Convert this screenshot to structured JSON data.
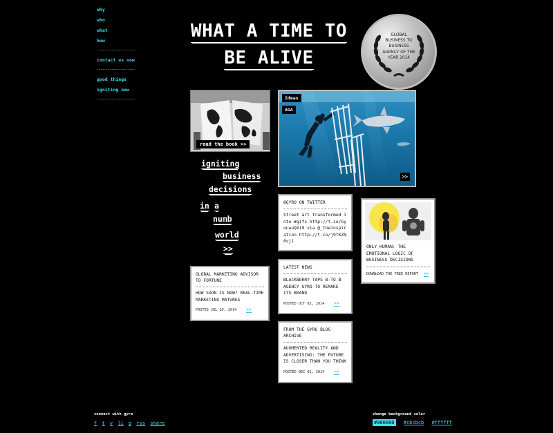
{
  "nav": {
    "items": [
      "why",
      "who",
      "what",
      "how"
    ],
    "separator": "------------------------",
    "contact": "contact us now",
    "good": "good things",
    "igniting_now": "igniting now"
  },
  "hero": {
    "line1": "WHAT A TIME TO",
    "line2": "BE ALIVE"
  },
  "badge": {
    "text": "GLOBAL BUSINESS TO BUSINESS AGENCY OF THE YEAR 2014"
  },
  "book": {
    "button": "read the book >>"
  },
  "igniting": {
    "w1": "igniting",
    "w2": "business",
    "w3": "decisions",
    "w4": "in",
    "w5": "a",
    "w6": "numb",
    "w7": "world",
    "w8": ">>"
  },
  "shark": {
    "tag1": "Ideas",
    "tag2": "AGA",
    "arrow": ">>"
  },
  "twitter": {
    "title": "@GYRO ON TWITTER",
    "body": "Street art transformed into #gifs http://t.co/GyuLwuQXi9 via @_theinspiration http://t.co/j9TKZN6vji"
  },
  "humans": {
    "title": "ONLY HUMAN: THE EMOTIONAL LOGIC OF BUSINESS DECISIONS",
    "link": "DOWNLOAD THE FREE REPORT",
    "more": ">>"
  },
  "news": {
    "title": "LATEST NEWS",
    "body": "BLACKBERRY TAPS B-TO-B AGENCY GYRO TO REMAKE ITS BRAND",
    "posted": "POSTED OCT 02, 2014",
    "more": ">>"
  },
  "fortune": {
    "title": "GLOBAL MARKETING ADVISOR TO FORTUNE",
    "body": "HOW SOON IS NOW? REAL-TIME MARKETING MATURES",
    "posted": "POSTED JUL 10, 2014",
    "more": ">>"
  },
  "blog": {
    "title": "FROM THE GYRO BLOG ARCHIVE",
    "body": "AUGMENTED REALITY AND ADVERTISING: THE FUTURE IS CLOSER THAN YOU THINK",
    "posted": "POSTED DEC 01, 2014",
    "more": ">>"
  },
  "footer": {
    "connect": "connect with gyro",
    "social": [
      "f",
      "t",
      "v",
      "li",
      "p",
      "rss",
      "share"
    ],
    "bg_label": "change background color",
    "swatches": [
      "#000000",
      "#cbcbcb",
      "#ffffff"
    ],
    "accent": "#3de0ef"
  }
}
